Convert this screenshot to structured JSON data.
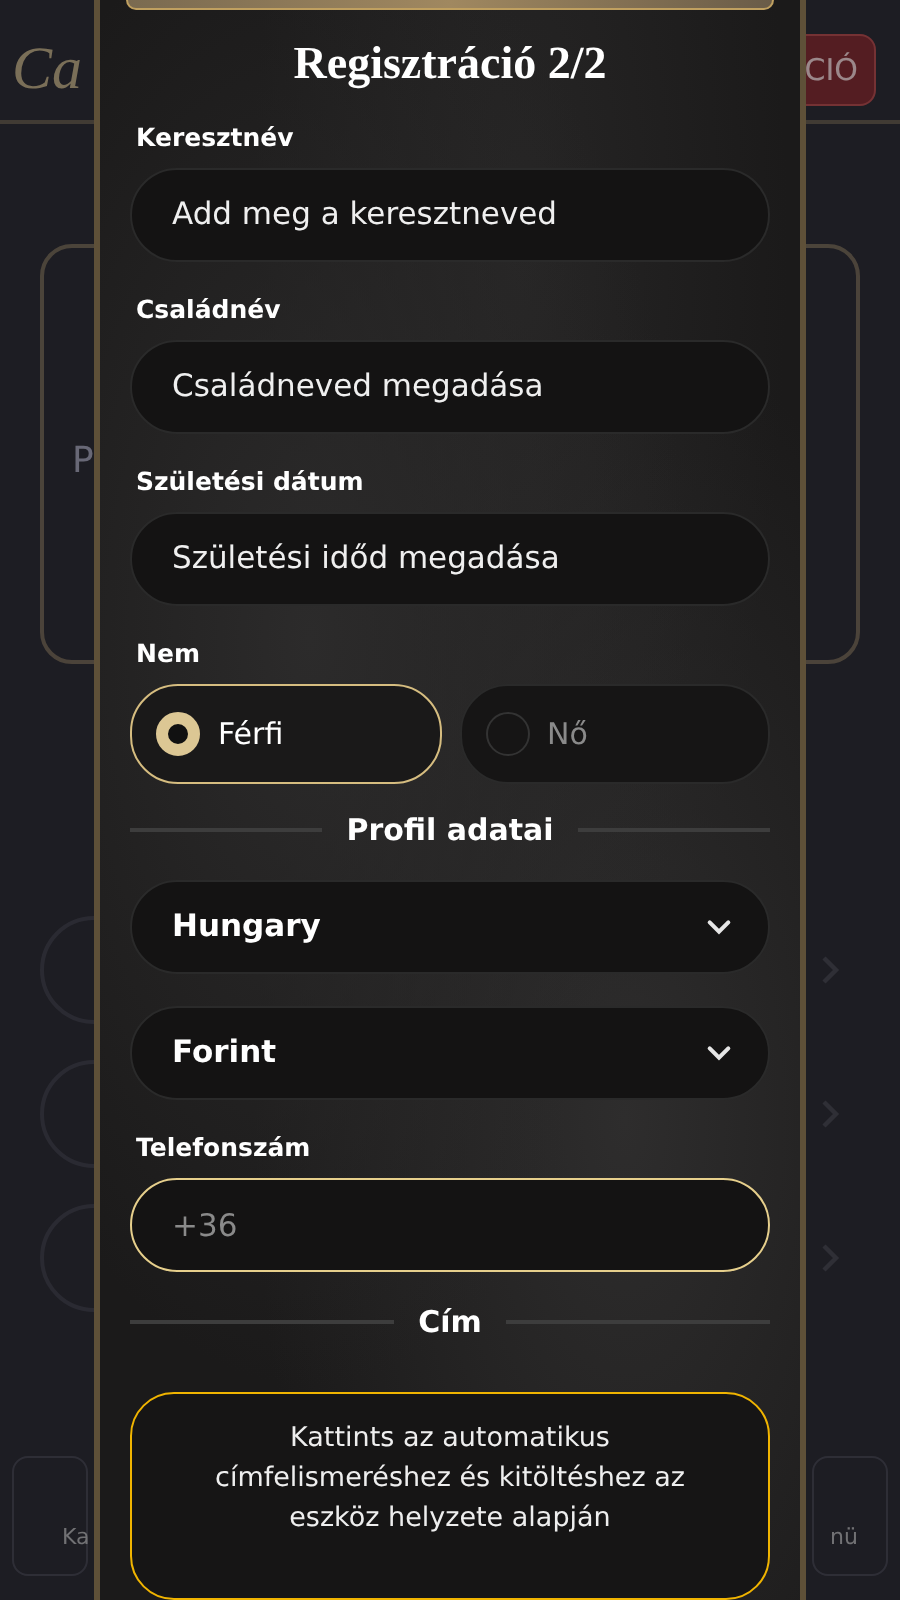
{
  "background": {
    "logo": "Ca",
    "header_button": "CIÓ",
    "card_labels": [
      "P"
    ],
    "nav_labels": [
      "Ka",
      "nü"
    ]
  },
  "modal": {
    "title": "Regisztráció 2/2",
    "fields": [
      {
        "label": "Keresztnév",
        "placeholder": "Add meg a keresztneved"
      },
      {
        "label": "Családnév",
        "placeholder": "Családneved megadása"
      },
      {
        "label": "Születési dátum",
        "placeholder": "Születési időd megadása"
      }
    ],
    "gender": {
      "label": "Nem",
      "options": [
        {
          "label": "Férfi",
          "selected": true
        },
        {
          "label": "Nő",
          "selected": false
        }
      ]
    },
    "profile_heading": "Profil adatai",
    "selects": [
      {
        "value": "Hungary"
      },
      {
        "value": "Forint"
      }
    ],
    "phone": {
      "label": "Telefonszám",
      "placeholder": "+36",
      "focused": true
    },
    "address_heading": "Cím",
    "auto_address_button": "Kattints az automatikus címfelismeréshez és kitöltéshez az eszköz helyzete alapján"
  }
}
